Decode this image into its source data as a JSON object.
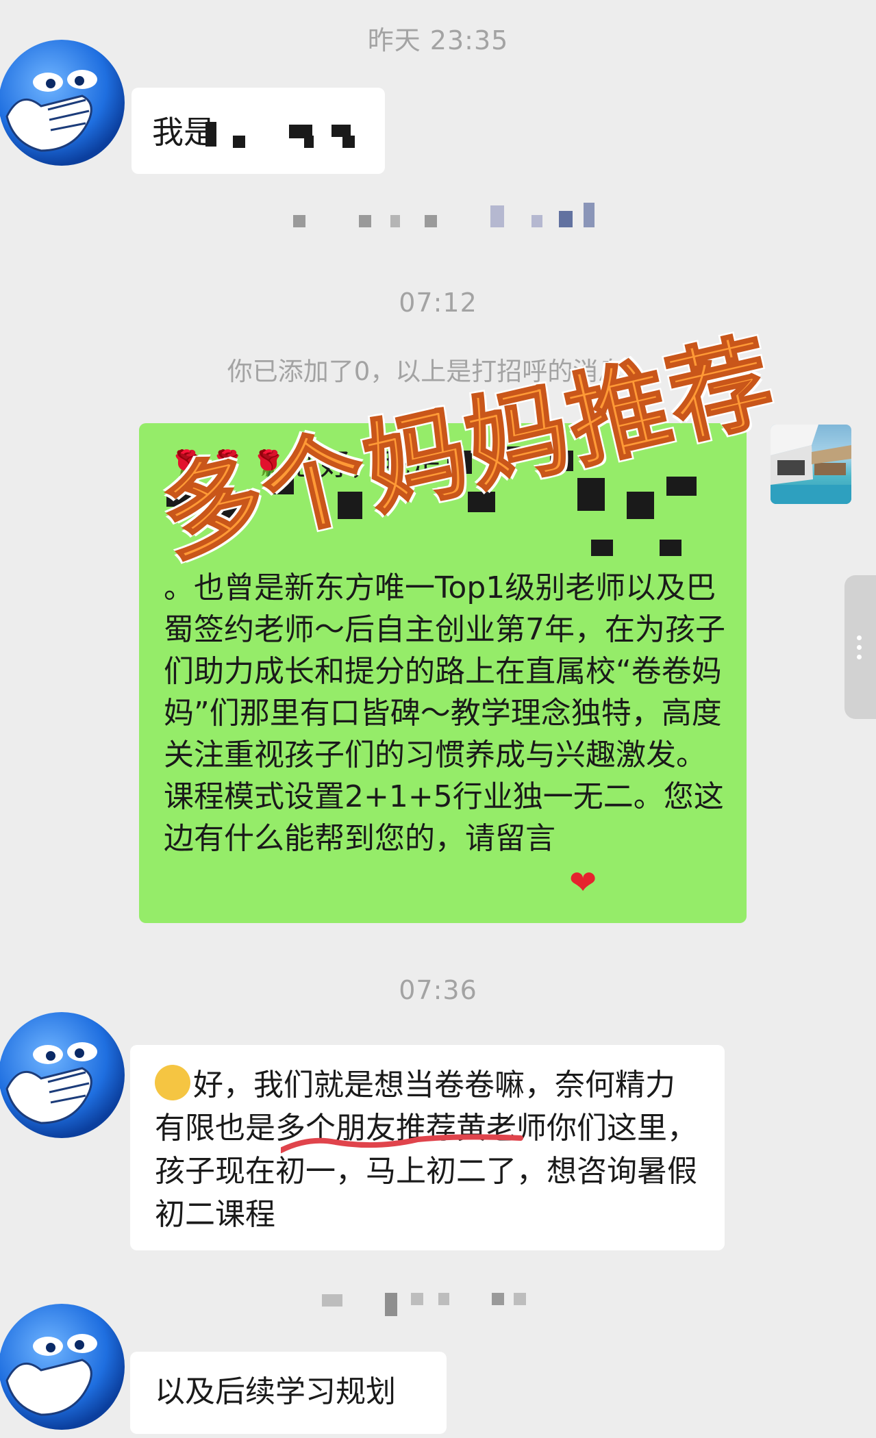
{
  "timestamps": [
    "昨天 23:35",
    "07:12",
    "07:36"
  ],
  "system_notice": "你已添加了0，以上是打招呼的消息。",
  "messages": {
    "m1_visible": "我是",
    "green_line1": "您好，我是",
    "green_body": "。也曾是新东方唯一Top1级别老师以及巴蜀签约老师～后自主创业第7年，在为孩子们助力成长和提分的路上在直属校“卷卷妈妈”们那里有口皆碑～教学理念独特，高度关注重视孩子们的习惯养成与兴趣激发。课程模式设置2+1+5行业独一无二。您这边有什么能帮到您的，请留言",
    "reply1": "好，我们就是想当卷卷嘛，奈何精力有限也是多个朋友推荐黄老师你们这里，孩子现在初一，马上初二了，想咨询暑假初二课程",
    "reply2": "以及后续学习规划"
  },
  "watermark": "多个妈妈推荐",
  "emoji": {
    "rose": "rose-emoji",
    "heart": "red-heart-emoji",
    "thinking": "thinking-face-emoji"
  },
  "colors": {
    "background": "#ededed",
    "self_bubble": "#95ec69",
    "other_bubble": "#ffffff",
    "watermark": "#ff9a36",
    "underline": "#e0444c"
  }
}
